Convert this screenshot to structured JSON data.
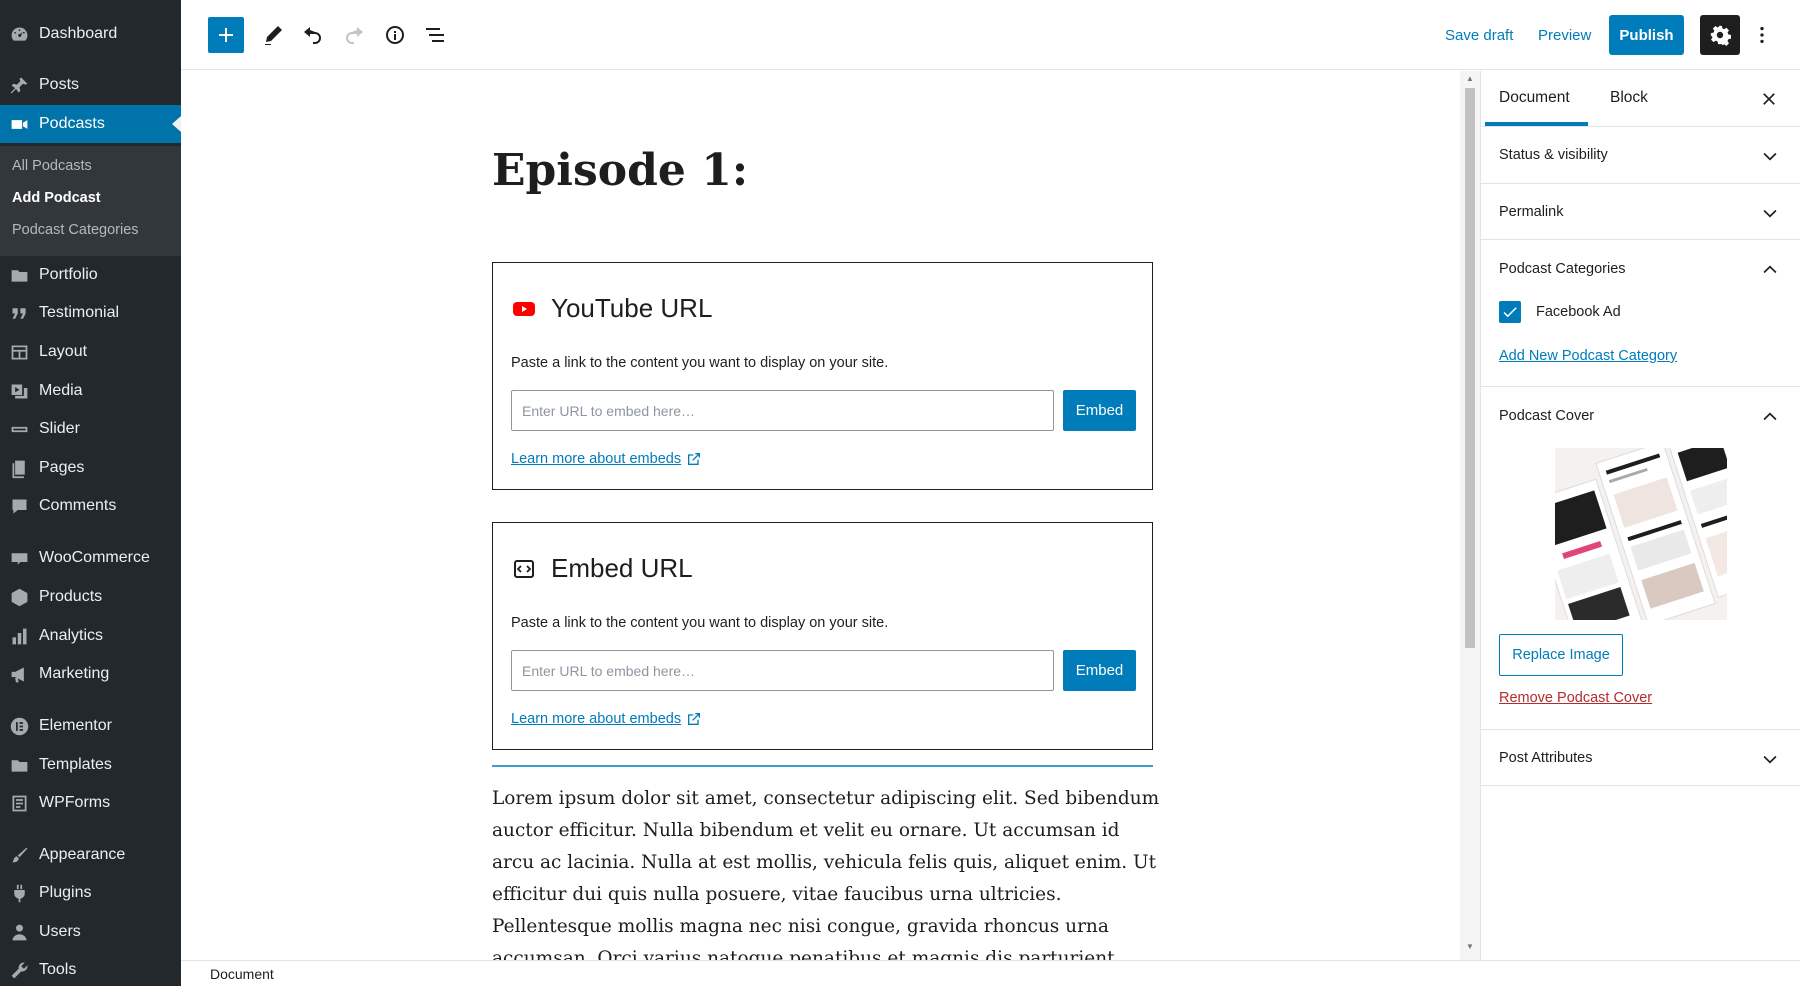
{
  "admin_menu": {
    "items": [
      {
        "label": "Dashboard",
        "icon": "dashboard-icon"
      },
      {
        "label": "Posts",
        "icon": "pin-icon"
      },
      {
        "label": "Podcasts",
        "icon": "video-camera-icon",
        "current": true
      },
      {
        "label": "Portfolio",
        "icon": "folder-icon"
      },
      {
        "label": "Testimonial",
        "icon": "quote-icon"
      },
      {
        "label": "Layout",
        "icon": "layout-icon"
      },
      {
        "label": "Media",
        "icon": "media-icon"
      },
      {
        "label": "Slider",
        "icon": "slider-icon"
      },
      {
        "label": "Pages",
        "icon": "pages-icon"
      },
      {
        "label": "Comments",
        "icon": "comment-icon"
      },
      {
        "label": "WooCommerce",
        "icon": "woocommerce-icon"
      },
      {
        "label": "Products",
        "icon": "products-icon"
      },
      {
        "label": "Analytics",
        "icon": "bar-chart-icon"
      },
      {
        "label": "Marketing",
        "icon": "megaphone-icon"
      },
      {
        "label": "Elementor",
        "icon": "elementor-icon"
      },
      {
        "label": "Templates",
        "icon": "folder-icon"
      },
      {
        "label": "WPForms",
        "icon": "form-icon"
      },
      {
        "label": "Appearance",
        "icon": "brush-icon"
      },
      {
        "label": "Plugins",
        "icon": "plug-icon"
      },
      {
        "label": "Users",
        "icon": "user-icon"
      },
      {
        "label": "Tools",
        "icon": "wrench-icon"
      }
    ],
    "submenu": [
      {
        "label": "All Podcasts"
      },
      {
        "label": "Add Podcast",
        "current": true
      },
      {
        "label": "Podcast Categories"
      }
    ]
  },
  "toolbar": {
    "save_draft": "Save draft",
    "preview": "Preview",
    "publish": "Publish"
  },
  "editor": {
    "title": "Episode 1:",
    "embeds": [
      {
        "title": "YouTube URL",
        "icon": "youtube-icon",
        "description": "Paste a link to the content you want to display on your site.",
        "placeholder": "Enter URL to embed here…",
        "button": "Embed",
        "learn_more": "Learn more about embeds"
      },
      {
        "title": "Embed URL",
        "icon": "embed-generic-icon",
        "description": "Paste a link to the content you want to display on your site.",
        "placeholder": "Enter URL to embed here…",
        "button": "Embed",
        "learn_more": "Learn more about embeds"
      }
    ],
    "paragraph": "Lorem ipsum dolor sit amet, consectetur adipiscing elit. Sed bibendum auctor efficitur. Nulla bibendum et velit eu ornare. Ut accumsan id arcu ac lacinia. Nulla at est mollis, vehicula felis quis, aliquet enim. Ut efficitur dui quis nulla posuere, vitae faucibus urna ultricies. Pellentesque mollis magna nec nisi congue, gravida rhoncus urna accumsan. Orci varius natoque penatibus et magnis dis parturient montes, nascetur ridiculus mus."
  },
  "footer": {
    "breadcrumb": "Document"
  },
  "settings": {
    "tabs": {
      "document": "Document",
      "block": "Block"
    },
    "panels": {
      "status": "Status & visibility",
      "permalink": "Permalink",
      "categories": "Podcast Categories",
      "cover": "Podcast Cover",
      "attributes": "Post Attributes"
    },
    "category_item": "Facebook Ad",
    "category_checked": true,
    "add_category": "Add New Podcast Category",
    "replace_image": "Replace Image",
    "remove_cover": "Remove Podcast Cover"
  },
  "colors": {
    "accent": "#007cba",
    "admin_bg": "#23282d",
    "youtube_red": "#ff0000",
    "danger": "#b32d2e"
  }
}
